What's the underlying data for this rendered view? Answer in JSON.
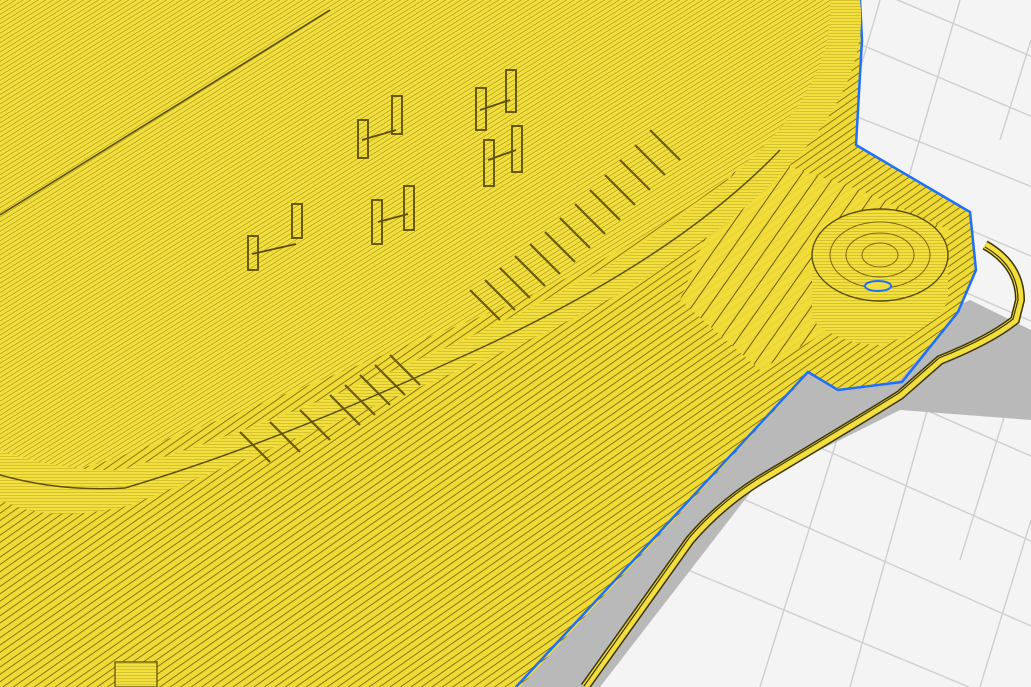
{
  "viewer": {
    "mode": "layer-preview",
    "colors": {
      "build_plate": "#f4f4f4",
      "grid_line": "#cfcfcf",
      "model_top": "#f2de3c",
      "model_shade": "#d9c22a",
      "line_dark": "#7a6a0a",
      "shadow": "#b9b9b9",
      "outline_highlight": "#1e6fff"
    },
    "icons": [
      "build-plate-grid",
      "sliced-model",
      "round-boss",
      "brim-skirt"
    ]
  }
}
